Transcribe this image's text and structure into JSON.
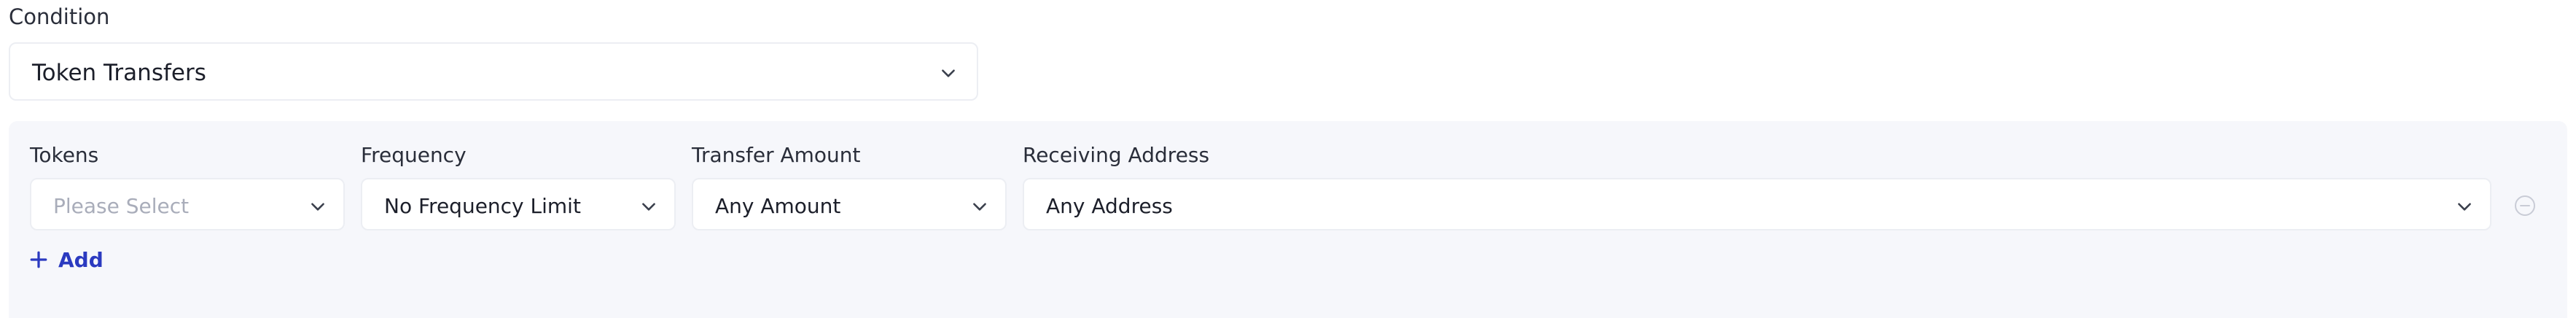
{
  "condition": {
    "label": "Condition",
    "value": "Token Transfers",
    "dropdown_icon": "chevron-down-icon"
  },
  "rule": {
    "fields": [
      {
        "label": "Tokens",
        "value": "",
        "placeholder": "Please Select"
      },
      {
        "label": "Frequency",
        "value": "No Frequency Limit",
        "placeholder": ""
      },
      {
        "label": "Transfer Amount",
        "value": "Any Amount",
        "placeholder": ""
      },
      {
        "label": "Receiving Address",
        "value": "Any Address",
        "placeholder": ""
      }
    ],
    "remove_icon": "minus-circle-icon",
    "add_icon": "plus-icon",
    "add_label": "Add"
  },
  "colors": {
    "accent": "#2b3ac0",
    "panel_bg": "#f6f7fb",
    "border": "#eceef3",
    "placeholder": "#a9adba"
  }
}
